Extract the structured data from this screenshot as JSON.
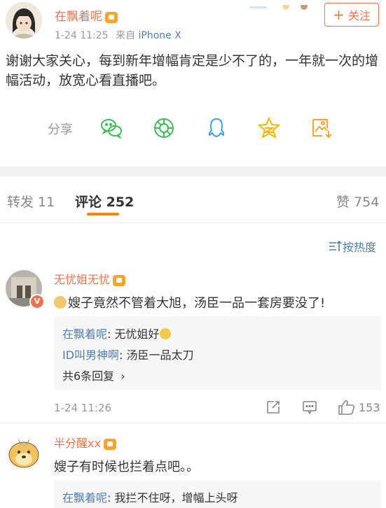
{
  "post": {
    "author": "在飘着呢",
    "time": "1-24 11:25",
    "source_prefix": "来自",
    "source": "iPhone X",
    "follow_label": "关注",
    "text": "谢谢大家关心，每到新年增幅肯定是少不了的，一年就一次的增幅活动，放宽心看直播吧。",
    "share_label": "分享",
    "share_icons": [
      "wechat-icon",
      "moments-icon",
      "qq-icon",
      "qzone-icon",
      "save-image-icon"
    ]
  },
  "tabs": {
    "repost": "转发 11",
    "comments": "评论 252",
    "likes": "赞 754"
  },
  "sort_label": "按热度",
  "comments": [
    {
      "author": "无忧姐无忧",
      "text": "嫂子竟然不管着大旭，汤臣一品一套房要没了!",
      "replies": [
        {
          "author": "在飘着呢",
          "text": "无忧姐好"
        },
        {
          "author": "ID叫男神啊",
          "text": "汤臣一品太刀"
        }
      ],
      "more_replies": "共6条回复",
      "time": "1-24 11:26",
      "likes": "153"
    },
    {
      "author": "半分醒xx",
      "text": "嫂子有时候也拦着点吧。。",
      "replies": [
        {
          "author": "在飘着呢",
          "text": "我拦不住呀，增幅上头呀"
        }
      ]
    }
  ],
  "colors": {
    "accent": "#eb7350",
    "link": "#507daf",
    "tab_underline": "#ff8200"
  }
}
